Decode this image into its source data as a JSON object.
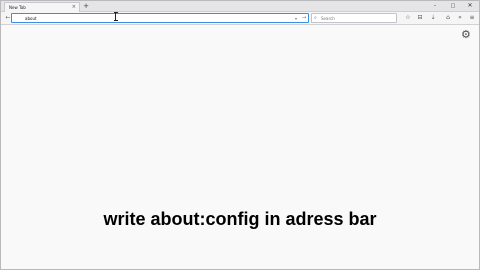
{
  "tab": {
    "title": "New Tab",
    "close": "×"
  },
  "new_tab": "+",
  "window_controls": {
    "minimize": "–",
    "maximize": "□",
    "close": "✕"
  },
  "nav": {
    "back": "←"
  },
  "urlbar": {
    "value": "about",
    "dropdown": "▾",
    "go": "→"
  },
  "search": {
    "icon": "⌕",
    "placeholder": "Search"
  },
  "toolbar_icons": {
    "bookmark": "☆",
    "library": "⊟",
    "downloads": "⇣",
    "home": "⌂",
    "overflow": "»",
    "menu": "≡"
  },
  "content": {
    "settings_icon": "⚙"
  },
  "caption": "write about:config in adress bar"
}
